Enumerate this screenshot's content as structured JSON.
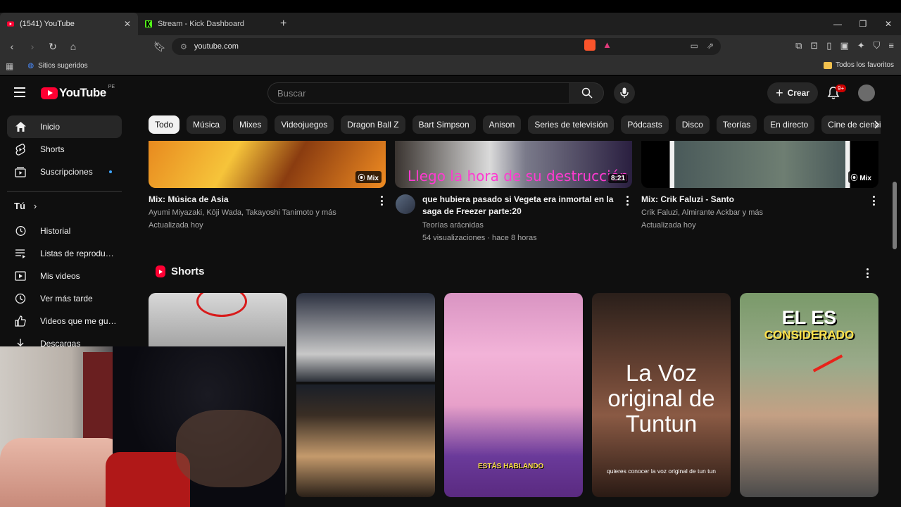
{
  "browser": {
    "tabs": [
      {
        "title": "(1541) YouTube",
        "active": true
      },
      {
        "title": "Stream - Kick Dashboard",
        "active": false
      }
    ],
    "url": "youtube.com",
    "bookmarks": {
      "suggested": "Sitios sugeridos",
      "all": "Todos los favoritos"
    }
  },
  "yt": {
    "logo": "YouTube",
    "country": "PE",
    "search_placeholder": "Buscar",
    "create_label": "Crear",
    "notif_count": "9+"
  },
  "sidebar": {
    "items": [
      {
        "label": "Inicio",
        "icon": "home-icon"
      },
      {
        "label": "Shorts",
        "icon": "shorts-icon"
      },
      {
        "label": "Suscripciones",
        "icon": "subscriptions-icon"
      }
    ],
    "you_label": "Tú",
    "you_items": [
      {
        "label": "Historial",
        "icon": "history-icon"
      },
      {
        "label": "Listas de reproducc...",
        "icon": "playlists-icon"
      },
      {
        "label": "Mis videos",
        "icon": "my-videos-icon"
      },
      {
        "label": "Ver más tarde",
        "icon": "watch-later-icon"
      },
      {
        "label": "Videos que me gust...",
        "icon": "liked-icon"
      },
      {
        "label": "Descargas",
        "icon": "download-icon"
      }
    ]
  },
  "chips": [
    "Todo",
    "Música",
    "Mixes",
    "Videojuegos",
    "Dragon Ball Z",
    "Bart Simpson",
    "Anison",
    "Series de televisión",
    "Pódcasts",
    "Disco",
    "Teorías",
    "En directo",
    "Cine de ciencia"
  ],
  "videos": [
    {
      "title": "Mix: Música de Asia",
      "channel": "Ayumi Miyazaki, Kōji Wada, Takayoshi Tanimoto y más",
      "meta": "Actualizada hoy",
      "badge": "Mix"
    },
    {
      "title": "que hubiera pasado si Vegeta era inmortal en la saga de Freezer parte:20",
      "channel": "Teorías arácnidas",
      "meta": "54 visualizaciones · hace 8 horas",
      "badge": "8:21",
      "caption": "Llego la hora de su destrucción"
    },
    {
      "title": "Mix: Crik Faluzi - Santo",
      "channel": "Crik Faluzi, Almirante Ackbar y más",
      "meta": "Actualizada hoy",
      "badge": "Mix"
    }
  ],
  "shorts": {
    "title": "Shorts",
    "items": [
      {
        "text": ""
      },
      {
        "text": ""
      },
      {
        "text": "ESTÁS HABLANDO"
      },
      {
        "text": "La Voz original de Tuntun",
        "sub": "quieres conocer la voz original de tun tun"
      },
      {
        "text": "EL ES",
        "sub": "CONSIDERADO"
      }
    ]
  }
}
